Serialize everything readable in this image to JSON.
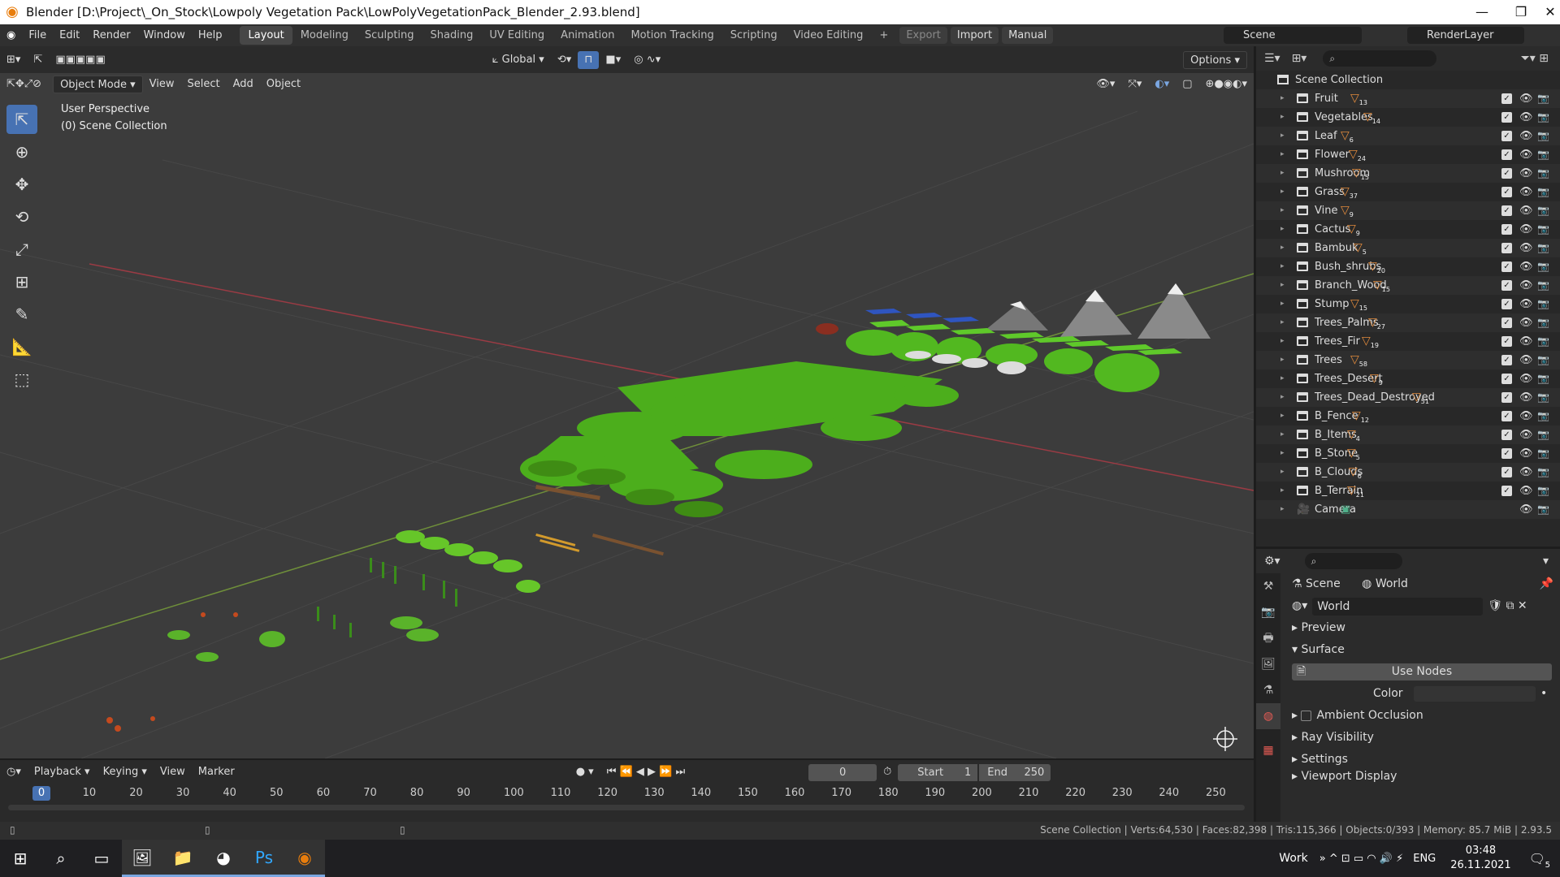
{
  "window": {
    "title": "Blender [D:\\Project\\_On_Stock\\Lowpoly Vegetation Pack\\LowPolyVegetationPack_Blender_2.93.blend]"
  },
  "menu": [
    "File",
    "Edit",
    "Render",
    "Window",
    "Help"
  ],
  "workspaces": [
    {
      "label": "Layout",
      "active": true
    },
    {
      "label": "Modeling"
    },
    {
      "label": "Sculpting"
    },
    {
      "label": "Shading"
    },
    {
      "label": "UV Editing"
    },
    {
      "label": "Animation"
    },
    {
      "label": "Motion Tracking"
    },
    {
      "label": "Scripting"
    },
    {
      "label": "Video Editing"
    }
  ],
  "top_buttons": {
    "export": "Export",
    "import": "Import",
    "manual": "Manual"
  },
  "scene_name": "Scene",
  "render_layer": "RenderLayer",
  "viewport": {
    "transform": "Global",
    "options": "Options",
    "mode": "Object Mode",
    "menus": [
      "View",
      "Select",
      "Add",
      "Object"
    ],
    "perspective_label": "User Perspective",
    "collection_label": "(0) Scene Collection"
  },
  "outliner": {
    "root": "Scene Collection",
    "items": [
      {
        "name": "Fruit",
        "count": "13"
      },
      {
        "name": "Vegetables",
        "count": "14"
      },
      {
        "name": "Leaf",
        "count": "6"
      },
      {
        "name": "Flower",
        "count": "24"
      },
      {
        "name": "Mushroom",
        "count": "15"
      },
      {
        "name": "Grass",
        "count": "37"
      },
      {
        "name": "Vine",
        "count": "9"
      },
      {
        "name": "Cactus",
        "count": "9"
      },
      {
        "name": "Bambuk",
        "count": "5"
      },
      {
        "name": "Bush_shrubs",
        "count": "20"
      },
      {
        "name": "Branch_Wood",
        "count": "15"
      },
      {
        "name": "Stump",
        "count": "15"
      },
      {
        "name": "Trees_Palms",
        "count": "27"
      },
      {
        "name": "Trees_Fir",
        "count": "19"
      },
      {
        "name": "Trees",
        "count": "58"
      },
      {
        "name": "Trees_Desert",
        "count": "9"
      },
      {
        "name": "Trees_Dead_Destroyed",
        "count": "51"
      },
      {
        "name": "B_Fence",
        "count": "12"
      },
      {
        "name": "B_Items",
        "count": "4"
      },
      {
        "name": "B_Stone",
        "count": "5"
      },
      {
        "name": "B_Clouds",
        "count": "6"
      },
      {
        "name": "B_Terrain",
        "count": "21"
      },
      {
        "name": "Camera",
        "count": ""
      }
    ]
  },
  "properties": {
    "breadcrumb_scene": "Scene",
    "breadcrumb_world": "World",
    "world_name": "World",
    "panels": {
      "preview": "Preview",
      "surface": "Surface",
      "use_nodes": "Use Nodes",
      "color": "Color",
      "ambient_occlusion": "Ambient Occlusion",
      "ray_visibility": "Ray Visibility",
      "settings": "Settings",
      "viewport_display": "Viewport Display"
    }
  },
  "timeline": {
    "menus": [
      "Playback",
      "Keying",
      "View",
      "Marker"
    ],
    "current_frame": "0",
    "start_label": "Start",
    "start": "1",
    "end_label": "End",
    "end": "250",
    "ticks": [
      "0",
      "10",
      "20",
      "30",
      "40",
      "50",
      "60",
      "70",
      "80",
      "90",
      "100",
      "110",
      "120",
      "130",
      "140",
      "150",
      "160",
      "170",
      "180",
      "190",
      "200",
      "210",
      "220",
      "230",
      "240",
      "250"
    ]
  },
  "statusbar": {
    "text": "Scene Collection | Verts:64,530 | Faces:82,398 | Tris:115,366 | Objects:0/393 | Memory: 85.7 MiB | 2.93.5"
  },
  "taskbar": {
    "work": "Work",
    "lang": "ENG",
    "time": "03:48",
    "date": "26.11.2021",
    "notif": "5"
  }
}
